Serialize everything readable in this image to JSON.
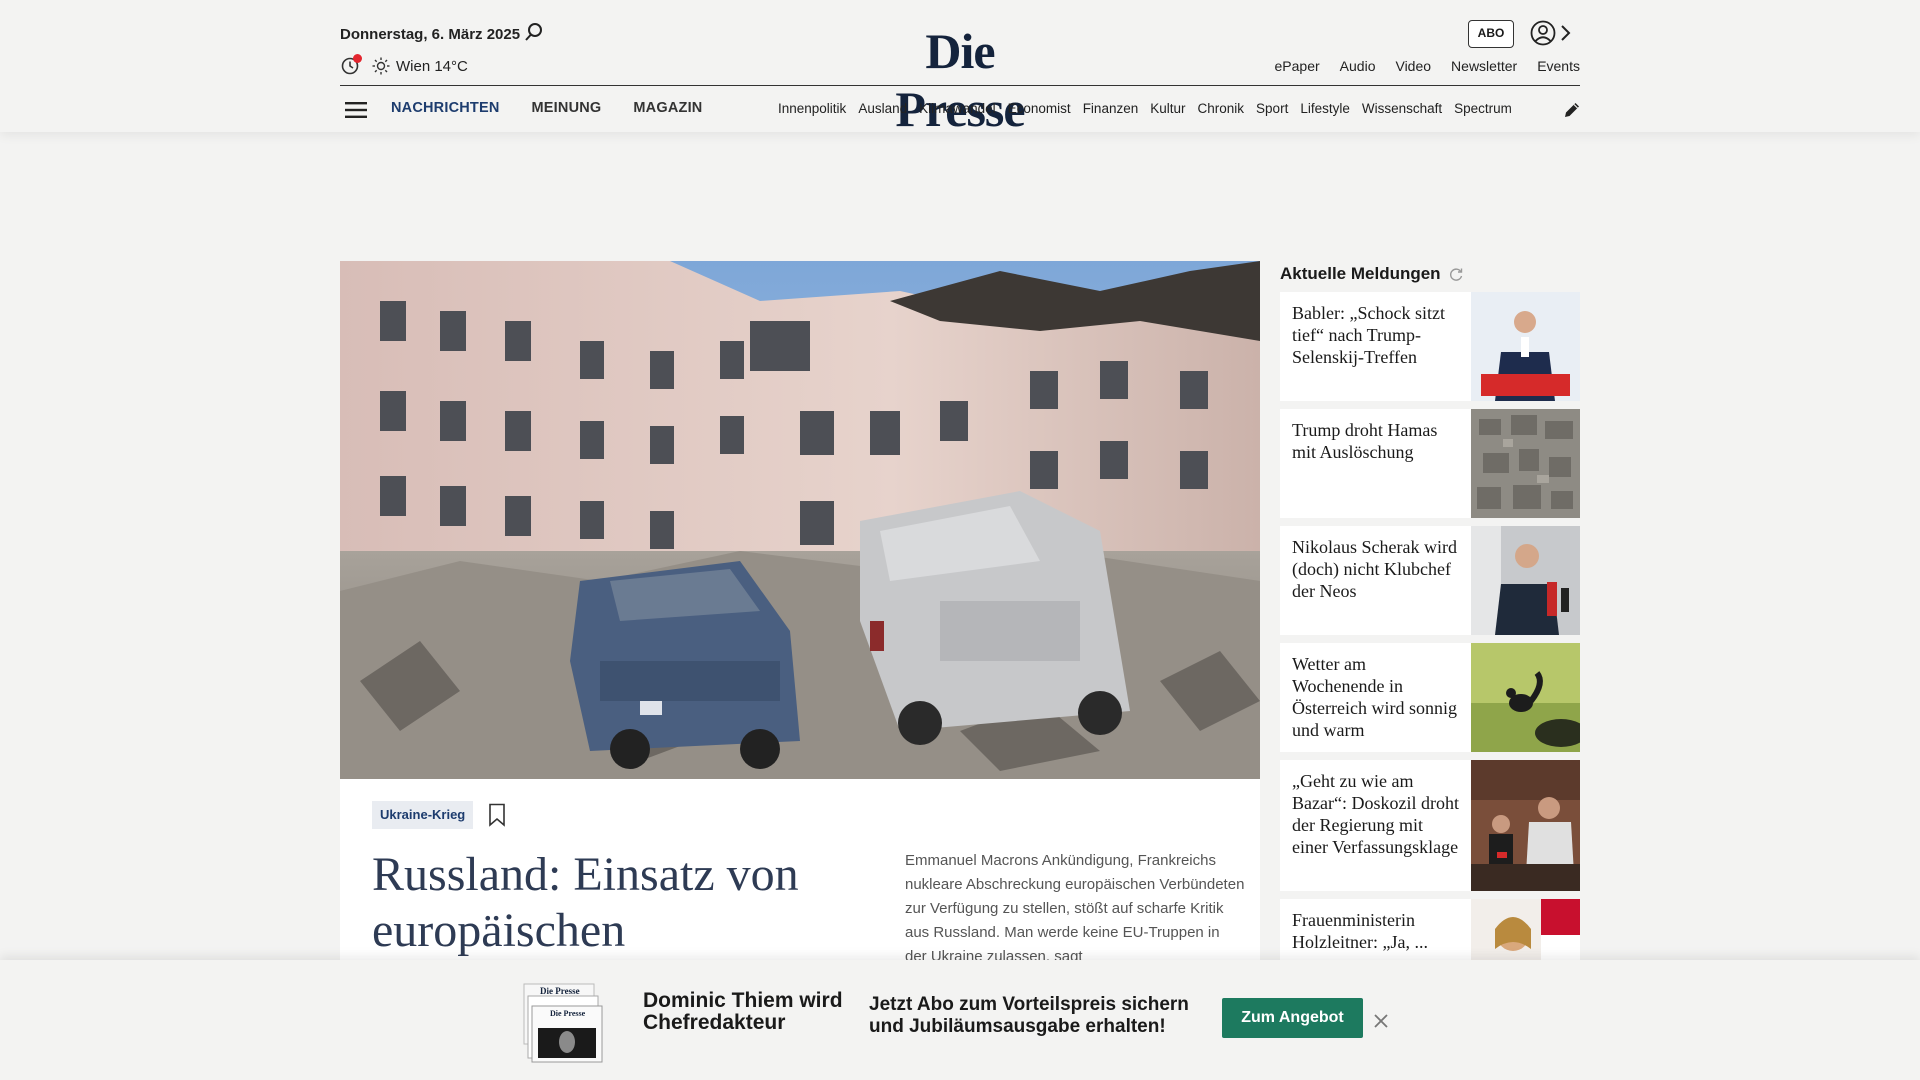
{
  "header": {
    "date": "Donnerstag, 6. März 2025",
    "weather": "Wien 14°C",
    "logo": "Die Presse",
    "abo_label": "ABO",
    "top_links": [
      "ePaper",
      "Audio",
      "Video",
      "Newsletter",
      "Events"
    ],
    "main_nav": [
      {
        "label": "NACHRICHTEN",
        "active": true
      },
      {
        "label": "MEINUNG",
        "active": false
      },
      {
        "label": "MAGAZIN",
        "active": false
      }
    ],
    "sub_nav": [
      "Innenpolitik",
      "Ausland",
      "Klimawandel",
      "Economist",
      "Finanzen",
      "Kultur",
      "Chronik",
      "Sport",
      "Lifestyle",
      "Wissenschaft",
      "Spectrum"
    ]
  },
  "article": {
    "tag": "Ukraine-Krieg",
    "headline": "Russland: Einsatz von europäischen",
    "lead": "Emmanuel Macrons Ankündigung, Frankreichs nukleare Abschreckung europäischen Verbündeten zur Verfügung zu stellen, stößt auf scharfe Kritik aus Russland. Man werde keine EU-Truppen in der Ukraine zulassen, sagt"
  },
  "sidebar": {
    "title": "Aktuelle Meldungen",
    "items": [
      {
        "text": "Babler: „Schock sitzt tief“ nach Trump-Selenskij-Treffen",
        "thumb": "politician-speech-photo"
      },
      {
        "text": "Trump droht Hamas mit Auslöschung",
        "thumb": "aerial-destruction-photo"
      },
      {
        "text": "Nikolaus Scherak wird (doch) nicht Klubchef der Neos",
        "thumb": "press-microphones-photo"
      },
      {
        "text": "Wetter am Wochenende in Österreich wird sonnig und warm",
        "thumb": "squirrel-meadow-photo"
      },
      {
        "text": "„Geht zu wie am Bazar“: Doskozil droht der Regierung mit einer Verfassungsklage",
        "thumb": "parliament-speaker-photo"
      },
      {
        "text": "Frauenministerin Holzleitner: „Ja, ...",
        "thumb": "minister-flag-photo"
      }
    ]
  },
  "banner": {
    "title": "Dominic Thiem wird Chefredakteur",
    "text": "Jetzt Abo zum Vorteilspreis sichern und Jubiläumsausgabe erhalten!",
    "button": "Zum Angebot",
    "paper_logo": "Die Presse"
  },
  "colors": {
    "brand_navy": "#14233c",
    "nav_active": "#1d3c6e",
    "cta_green": "#1d7a5f",
    "alert_red": "#e3262f"
  }
}
